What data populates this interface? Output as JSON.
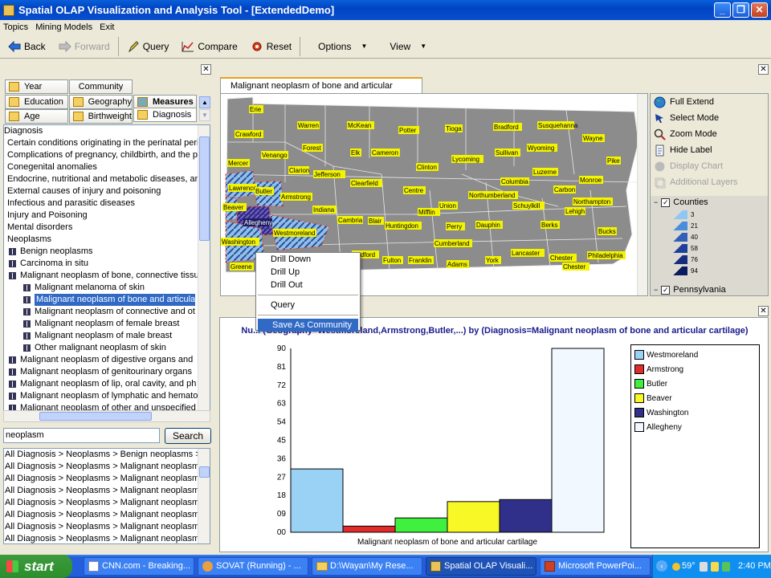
{
  "window": {
    "title": "Spatial OLAP Visualization and Analysis Tool - [ExtendedDemo]"
  },
  "menu": [
    "Topics",
    "Mining Models",
    "Exit"
  ],
  "toolbar": {
    "back": "Back",
    "forward": "Forward",
    "query": "Query",
    "compare": "Compare",
    "reset": "Reset",
    "options": "Options",
    "view": "View"
  },
  "dimension_tabs": {
    "year": "Year",
    "community": "Community",
    "education": "Education",
    "geography": "Geography",
    "measures": "Measures",
    "age": "Age",
    "birthweight": "Birthweight",
    "diagnosis": "Diagnosis"
  },
  "tree": [
    "Diagnosis",
    "Certain conditions originating in the perinatal peri",
    "Complications of pregnancy, childbirth, and the p",
    "Conegenital anomalies",
    "Endocrine, nutritional and metabolic diseases, an",
    "External causes of injury and poisoning",
    "Infectious and parasitic diseases",
    "Injury and Poisoning",
    "Mental disorders",
    "Neoplasms",
    "Benign neoplasms",
    "Carcinoma in situ",
    "Malignant neoplasm of bone, connective tissu",
    "Malignant melanoma of skin",
    "Malignant neoplasm of bone and articular",
    "Malignant neoplasm of connective and ot",
    "Malignant neoplasm of female breast",
    "Malignant neoplasm of male breast",
    "Other malignant neoplasm of skin",
    "Malignant neoplasm of digestive organs and",
    "Malignant neoplasm of genitourinary organs",
    "Malignant neoplasm of lip, oral cavity, and ph",
    "Malignant neoplasm of lymphatic and hemato",
    "Malignant neoplasm of other and unspecified"
  ],
  "search": {
    "value": "neoplasm",
    "button": "Search"
  },
  "results": [
    "All Diagnosis > Neoplasms > Benign neoplasms >",
    "All Diagnosis > Neoplasms > Malignant neoplasm",
    "All Diagnosis > Neoplasms > Malignant neoplasm",
    "All Diagnosis > Neoplasms > Malignant neoplasm",
    "All Diagnosis > Neoplasms > Malignant neoplasm",
    "All Diagnosis > Neoplasms > Malignant neoplasm",
    "All Diagnosis > Neoplasms > Malignant neoplasm",
    "All Diagnosis > Neoplasms > Malignant neoplasm"
  ],
  "map": {
    "tab": "Malignant neoplasm of bone and articular cartilage",
    "counties": [
      "Erie",
      "Warren",
      "McKean",
      "Potter",
      "Tioga",
      "Bradford",
      "Susquehanna",
      "Wayne",
      "Crawford",
      "Forest",
      "Elk",
      "Cameron",
      "Sullivan",
      "Wyoming",
      "Pike",
      "Venango",
      "Mercer",
      "Lycoming",
      "Clinton",
      "Clarion",
      "Jefferson",
      "Luzerne",
      "Monroe",
      "Columbia",
      "Lawrence",
      "Clearfield",
      "Centre",
      "Carbon",
      "Butler",
      "Armstrong",
      "Northumberland",
      "Northampton",
      "Beaver",
      "Indiana",
      "Union",
      "Schuylkill",
      "Lehigh",
      "Allegheny",
      "Mifflin",
      "Westmoreland",
      "Cambria",
      "Blair",
      "Perry",
      "Dauphin",
      "Berks",
      "Bucks",
      "Washington",
      "Huntingdon",
      "Cumberland",
      "Lancaster",
      "Chester",
      "Philadelphia",
      "Greene",
      "Bedford",
      "Fulton",
      "Franklin",
      "Adams",
      "York",
      "Chester"
    ]
  },
  "map_tools": {
    "full_extend": "Full Extend",
    "select_mode": "Select Mode",
    "zoom_mode": "Zoom Mode",
    "hide_label": "Hide Label",
    "display_chart": "Display Chart",
    "additional_layers": "Additional Layers"
  },
  "layers": {
    "counties": "Counties",
    "counties_classes": [
      "3",
      "21",
      "40",
      "58",
      "76",
      "94"
    ],
    "pennsylvania": "Pennsylvania"
  },
  "context_menu": {
    "drill_down": "Drill Down",
    "drill_up": "Drill Up",
    "drill_out": "Drill Out",
    "query": "Query",
    "save_as_community": "Save As Community"
  },
  "chart_title": "Nu...  (Geography=Westmoreland,Armstrong,Butler,...) by (Diagnosis=Malignant neoplasm of bone and articular cartilage)",
  "chart_data": {
    "type": "bar",
    "title": "Nu...  (Geography=Westmoreland,Armstrong,Butler,...) by (Diagnosis=Malignant neoplasm of bone and articular cartilage)",
    "categories": [
      "Malignant neoplasm of bone and articular cartilage"
    ],
    "xlabel": "Malignant neoplasm of bone and articular cartilage",
    "ylim": [
      0,
      90
    ],
    "yticks": [
      "00",
      "09",
      "18",
      "27",
      "36",
      "45",
      "54",
      "63",
      "72",
      "81",
      "90"
    ],
    "legend_position": "right",
    "series": [
      {
        "name": "Westmoreland",
        "values": [
          31
        ],
        "color": "#9ad2f6"
      },
      {
        "name": "Armstrong",
        "values": [
          3
        ],
        "color": "#e22b2b"
      },
      {
        "name": "Butler",
        "values": [
          7
        ],
        "color": "#3ff03f"
      },
      {
        "name": "Beaver",
        "values": [
          15
        ],
        "color": "#f8f826"
      },
      {
        "name": "Washington",
        "values": [
          16
        ],
        "color": "#30308a"
      },
      {
        "name": "Allegheny",
        "values": [
          90
        ],
        "color": "#f2f8ff"
      }
    ]
  },
  "taskbar": {
    "start": "start",
    "tasks": [
      "CNN.com - Breaking...",
      "SOVAT (Running) - ...",
      "D:\\Wayan\\My Rese...",
      "Spatial OLAP Visuali...",
      "Microsoft PowerPoi..."
    ],
    "temp": "59°",
    "time": "2:40 PM"
  }
}
